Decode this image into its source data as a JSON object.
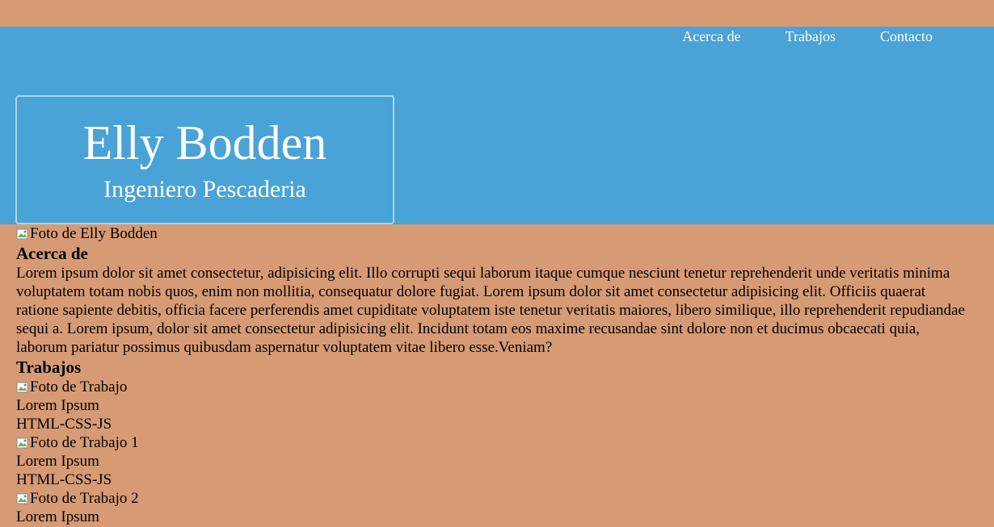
{
  "nav": {
    "items": [
      {
        "label": "Acerca de"
      },
      {
        "label": "Trabajos"
      },
      {
        "label": "Contacto"
      }
    ]
  },
  "hero": {
    "name": "Elly Bodden",
    "role": "Ingeniero Pescaderia"
  },
  "profile": {
    "photo_alt": "Foto de Elly Bodden"
  },
  "about": {
    "heading": "Acerca de",
    "text": "Lorem ipsum dolor sit amet consectetur, adipisicing elit. Illo corrupti sequi laborum itaque cumque nesciunt tenetur reprehenderit unde veritatis minima voluptatem totam nobis quos, enim non mollitia, consequatur dolore fugiat. Lorem ipsum dolor sit amet consectetur adipisicing elit. Officiis quaerat ratione sapiente debitis, officia facere perferendis amet cupiditate voluptatem iste tenetur veritatis maiores, libero similique, illo reprehenderit repudiandae sequi a. Lorem ipsum, dolor sit amet consectetur adipisicing elit. Incidunt totam eos maxime recusandae sint dolore non et ducimus obcaecati quia, laborum pariatur possimus quibusdam aspernatur voluptatem vitae libero esse.Veniam?"
  },
  "works": {
    "heading": "Trabajos",
    "items": [
      {
        "photo_alt": "Foto de Trabajo",
        "title": "Lorem Ipsum",
        "tech": "HTML-CSS-JS"
      },
      {
        "photo_alt": "Foto de Trabajo 1",
        "title": "Lorem Ipsum",
        "tech": "HTML-CSS-JS"
      },
      {
        "photo_alt": "Foto de Trabajo 2",
        "title": "Lorem Ipsum"
      }
    ]
  },
  "colors": {
    "page_bg": "#d69b74",
    "hero_bg": "#49a3d6",
    "hero_text": "#ffffff"
  },
  "icons": {
    "broken_image": "broken-image-icon"
  }
}
